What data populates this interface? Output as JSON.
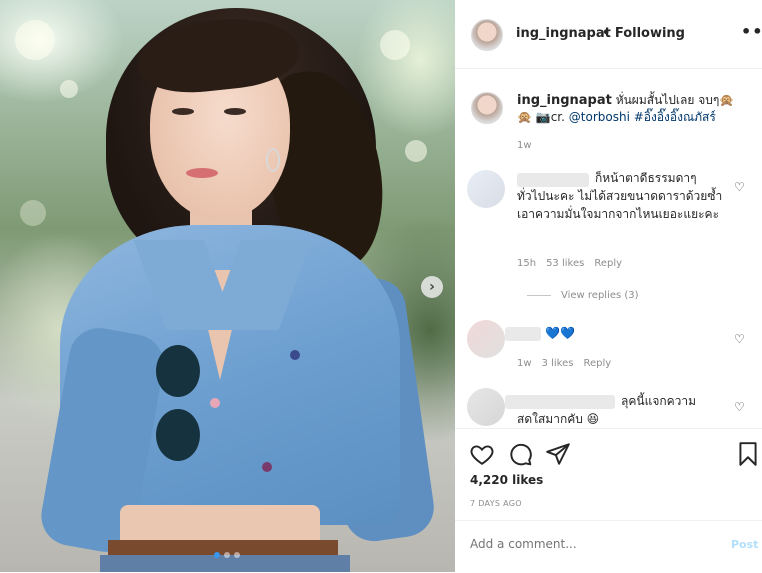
{
  "post": {
    "username": "ing_ingnapat",
    "follow_status": "• Following",
    "more_icon": "•••",
    "carousel_next": "›",
    "carousel_index": 1,
    "carousel_total": 3
  },
  "caption": {
    "username": "ing_ingnapat",
    "text": "หั่นผมสั้นไปเลย จบๆ🙊🙊 📷cr. ",
    "mention": "@torboshi",
    "hashtag": " #อิ๊งอิ๊งอิ๊งณภัสร์",
    "time": "1w"
  },
  "comments": [
    {
      "text": "ก็หน้าตาดีธรรมดาๆ ทั่วไปนะคะ ไม่ได้สวยขนาดดาราด้วยซ้ำ เอาความมั่นใจมากจากไหนเยอะแยะคะ",
      "time": "15h",
      "likes": "53 likes",
      "reply": "Reply",
      "view_replies": "View replies (3)"
    },
    {
      "text": "💙💙",
      "time": "1w",
      "likes": "3 likes",
      "reply": "Reply"
    },
    {
      "text": "ลุคนี้แจกความสดใสมากคับ 😆"
    }
  ],
  "actions": {
    "likes": "4,220 likes",
    "posted": "7 DAYS AGO"
  },
  "add_comment": {
    "placeholder": "Add a comment...",
    "post_label": "Post"
  },
  "colors": {
    "link": "#00376b",
    "post_button": "#b2dffc",
    "active_dot": "#3897f0"
  }
}
